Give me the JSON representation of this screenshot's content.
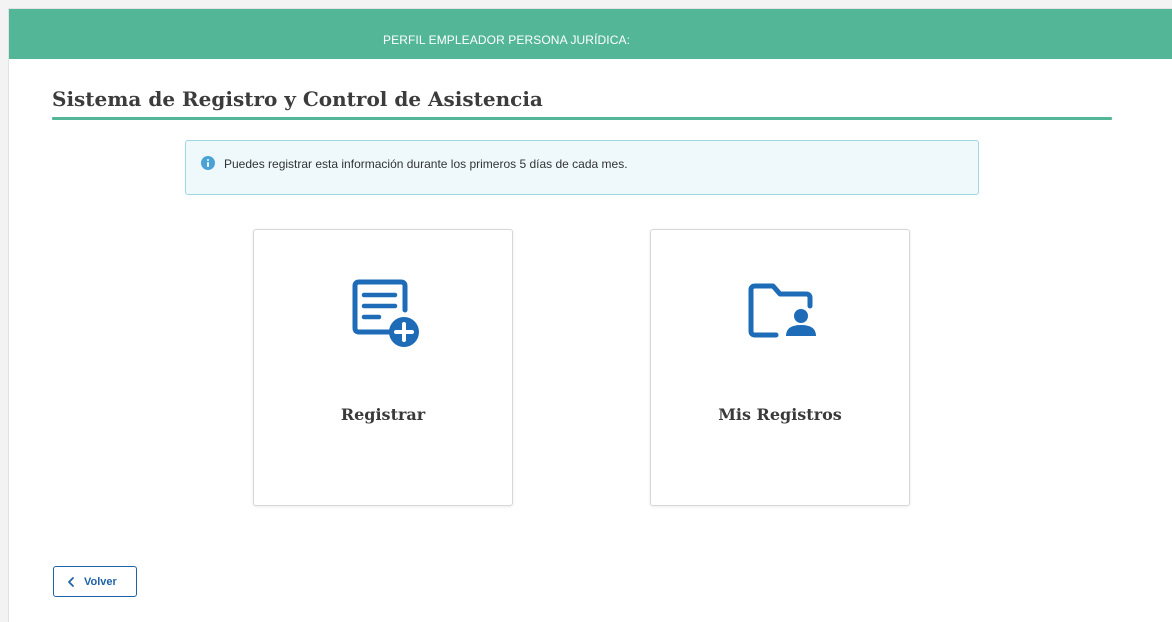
{
  "header": {
    "banner_text": "PERFIL EMPLEADOR PERSONA JURÍDICA:"
  },
  "main": {
    "title": "Sistema de Registro y Control de Asistencia",
    "alert": {
      "icon": "info-icon",
      "text": "Puedes registrar esta información durante los primeros 5 días de cada mes."
    },
    "cards": [
      {
        "label": "Registrar",
        "icon": "document-add-icon"
      },
      {
        "label": "Mis Registros",
        "icon": "folder-user-icon"
      }
    ]
  },
  "footer": {
    "back_label": "Volver",
    "back_icon": "chevron-left-icon"
  },
  "colors": {
    "banner": "#53b697",
    "accent_rule": "#53b697",
    "icon_blue": "#1e6bb8",
    "alert_bg": "#eff9fb",
    "alert_border": "#9fd8e4",
    "button_blue": "#1f62a8"
  }
}
